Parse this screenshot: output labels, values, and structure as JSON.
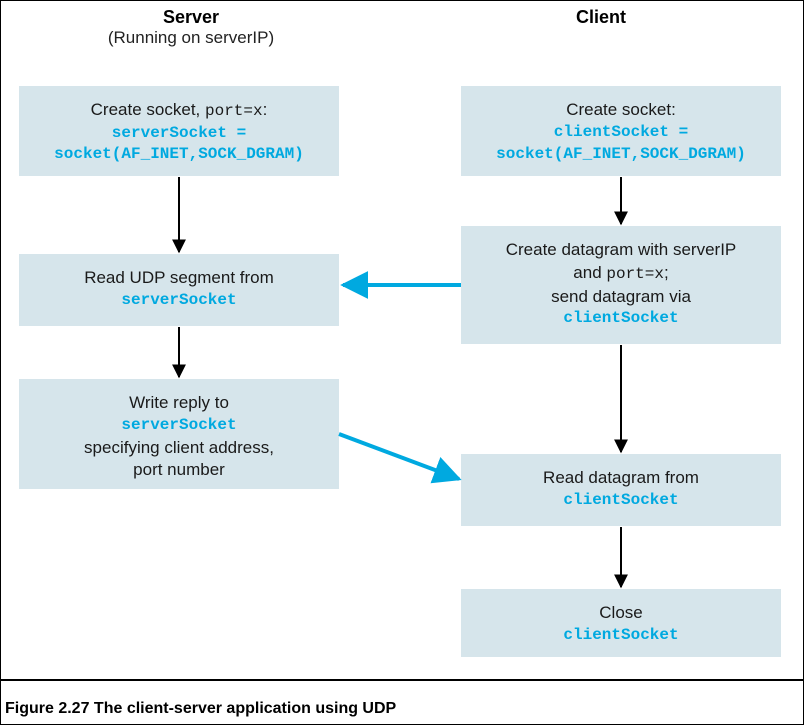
{
  "header": {
    "server_title": "Server",
    "server_subtitle": "(Running on serverIP)",
    "client_title": "Client"
  },
  "server": {
    "box1": {
      "line1_pre": "Create  socket, ",
      "line1_code": "port=x",
      "line1_post": ":",
      "code1": "serverSocket =",
      "code2": "socket(AF_INET,SOCK_DGRAM)"
    },
    "box2": {
      "line1": "Read UDP segment from",
      "code1": "serverSocket"
    },
    "box3": {
      "line1": "Write reply to",
      "code1": "serverSocket",
      "line2": "specifying client address,",
      "line3": "port number"
    }
  },
  "client": {
    "box1": {
      "line1": "Create socket:",
      "code1": "clientSocket =",
      "code2": "socket(AF_INET,SOCK_DGRAM)"
    },
    "box2": {
      "line1": "Create datagram with serverIP",
      "line2_pre": "and ",
      "line2_code": "port=x",
      "line2_post": ";",
      "line3": "send datagram via",
      "code1": "clientSocket"
    },
    "box3": {
      "line1": "Read datagram from",
      "code1": "clientSocket"
    },
    "box4": {
      "line1": "Close",
      "code1": "clientSocket"
    }
  },
  "caption": "Figure 2.27 The client-server application using UDP",
  "colors": {
    "box_bg": "#d6e5eb",
    "accent": "#00a9e0"
  }
}
